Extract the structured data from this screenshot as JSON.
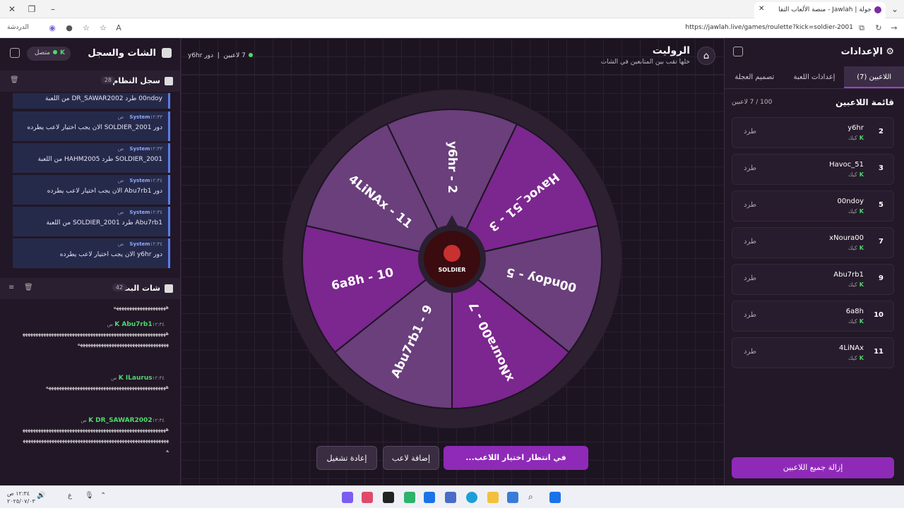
{
  "browser": {
    "tab_title": "جولة | Jawlah - منصة الألعاب التفا",
    "tab_close": "✕",
    "url": "https://jawlah.live/games/roulette?kick=soldier-2001",
    "private_label": "الدردشة"
  },
  "game": {
    "title": "الروليت",
    "subtitle": "خلها تقب بين المتابعين في الشات",
    "players_count_label": "7 لاعبين",
    "turn_label": "دور y6hr",
    "center_logo_text": "SOLDIER"
  },
  "wheel": {
    "segments": [
      {
        "label": "y6hr - 2",
        "color": "#6a3f7c"
      },
      {
        "label": "Havoc_51 - 3",
        "color": "#7c268f"
      },
      {
        "label": "00ndoy - 5",
        "color": "#6a3f7c"
      },
      {
        "label": "xNoura00 - 7",
        "color": "#7c268f"
      },
      {
        "label": "Abu7rb1 - 9",
        "color": "#6a3f7c"
      },
      {
        "label": "6a8h - 10",
        "color": "#7c268f"
      },
      {
        "label": "4LiNAx - 11",
        "color": "#6a3f7c"
      }
    ]
  },
  "buttons": {
    "waiting": "في انتظار اختيار اللاعب...",
    "add_player": "إضافة لاعب",
    "restart": "إعادة تشغيل",
    "remove_all": "إزالة جميع اللاعبين"
  },
  "settings": {
    "title": "الإعدادات",
    "tabs": [
      "اللاعبين (7)",
      "إعدادات اللعبة",
      "تصميم العجلة"
    ],
    "players_title": "قائمة اللاعبين",
    "players_capacity": "100 / 7 لاعبين",
    "platform_label": "كيك",
    "kick_label": "طرد",
    "players": [
      {
        "num": "2",
        "name": "y6hr"
      },
      {
        "num": "3",
        "name": "Havoc_51"
      },
      {
        "num": "5",
        "name": "00ndoy"
      },
      {
        "num": "7",
        "name": "xNoura00"
      },
      {
        "num": "9",
        "name": "Abu7rb1"
      },
      {
        "num": "10",
        "name": "6a8h"
      },
      {
        "num": "11",
        "name": "4LiNAx"
      }
    ]
  },
  "chat": {
    "title": "الشات والسجل",
    "status": "متصل",
    "system_log_title": "سجل النظام",
    "system_log_count": "28",
    "first_log": "00ndoy طرد DR_SAWAR2002 من اللعبة",
    "logs": [
      {
        "sender": "System",
        "time": "١٢:٣٣ ص",
        "msg": "دور SOLDIER_2001 الان يجب اختيار لاعب يطرده"
      },
      {
        "sender": "System",
        "time": "١٢:٣٣ ص",
        "msg": "SOLDIER_2001 طرد HAHM2005 من اللعبة"
      },
      {
        "sender": "System",
        "time": "١٢:٣٤ ص",
        "msg": "دور Abu7rb1 الان يجب اختيار لاعب يطرده"
      },
      {
        "sender": "System",
        "time": "١٢:٣٤ ص",
        "msg": "Abu7rb1 طرد SOLDIER_2001 من اللعبة"
      },
      {
        "sender": "System",
        "time": "١٢:٣٤ ص",
        "msg": "دور y6hr الان يجب اختيار لاعب يطرده"
      }
    ],
    "stream_chat_title": "شات البث",
    "stream_chat_count": "42",
    "top_msg": "ههههههههههههههههههههه",
    "messages": [
      {
        "user": "Abu7rb1",
        "time": "١٢:٣٤ ص",
        "text": "ههههههههههههههههههههههههههههههههههههههههههههههههههههههههههههههههههههههههههههههههههههههههههه"
      },
      {
        "user": "ILaurus",
        "time": "١٢:٣٤ ص",
        "text": "ههههههههههههههههههههههههههههههههههههههههههههههه"
      },
      {
        "user": "DR_SAWAR2002",
        "time": "١٢:٣٤ ص",
        "text": "ههههههههههههههههههههههههههههههههههههههههههههههههههههههههههههههههههههههههههههههههههههههههههههههههههههههههههههههههه"
      }
    ]
  },
  "taskbar": {
    "time": "١٢:٣٤ ص",
    "date": "٢٠٢٥/٠٧/٠٣",
    "lang": "ع"
  },
  "colors": {
    "accent": "#8f2ab8",
    "online": "#4ddb6b",
    "system_msg": "#5b7cf0"
  }
}
